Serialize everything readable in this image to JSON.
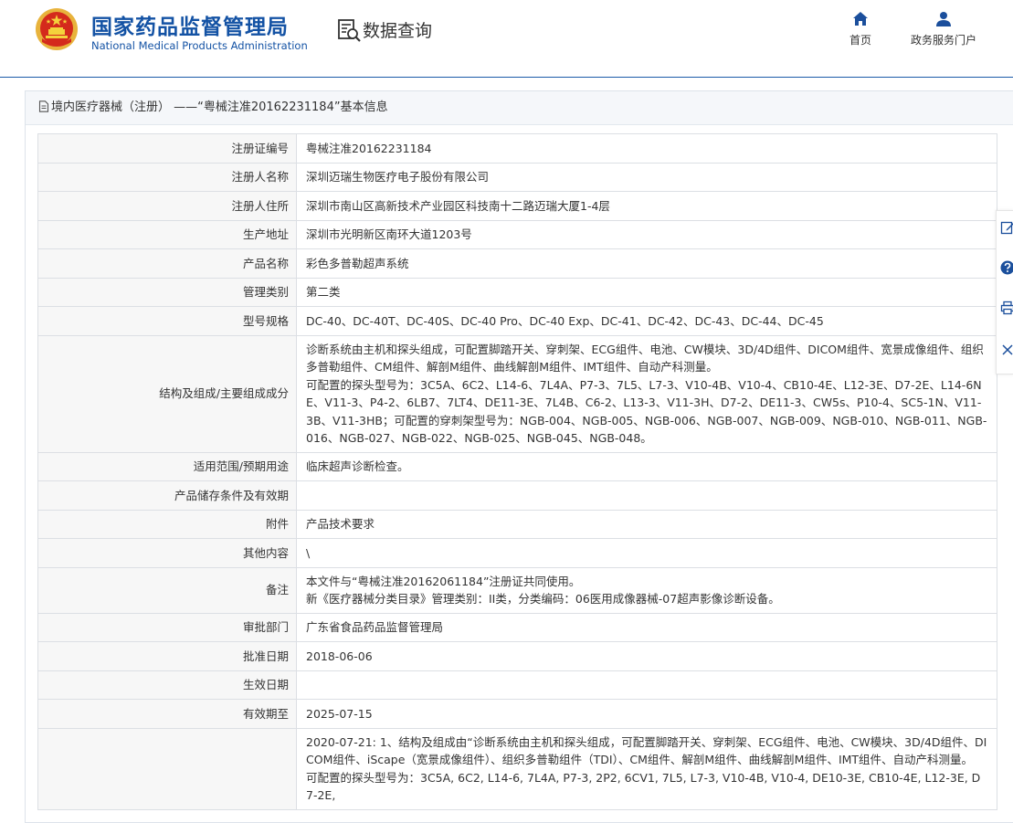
{
  "header": {
    "logo_cn": "国家药品监督管理局",
    "logo_en": "National Medical Products Administration",
    "section_title": "数据查询",
    "nav": [
      {
        "label": "首页",
        "icon": "home-icon"
      },
      {
        "label": "政务服务门户",
        "icon": "user-icon"
      }
    ],
    "brand_color": "#1352a4"
  },
  "panel": {
    "title": "境内医疗器械（注册） ——“粤械注准20162231184”基本信息"
  },
  "rows": [
    {
      "label": "注册证编号",
      "value": "粤械注准20162231184"
    },
    {
      "label": "注册人名称",
      "value": "深圳迈瑞生物医疗电子股份有限公司"
    },
    {
      "label": "注册人住所",
      "value": "深圳市南山区高新技术产业园区科技南十二路迈瑞大厦1-4层"
    },
    {
      "label": "生产地址",
      "value": "深圳市光明新区南环大道1203号"
    },
    {
      "label": "产品名称",
      "value": "彩色多普勒超声系统"
    },
    {
      "label": "管理类别",
      "value": "第二类"
    },
    {
      "label": "型号规格",
      "value": "DC-40、DC-40T、DC-40S、DC-40 Pro、DC-40 Exp、DC-41、DC-42、DC-43、DC-44、DC-45"
    },
    {
      "label": "结构及组成/主要组成成分",
      "lines": [
        "诊断系统由主机和探头组成，可配置脚踏开关、穿刺架、ECG组件、电池、CW模块、3D/4D组件、DICOM组件、宽景成像组件、组织多普勒组件、CM组件、解剖M组件、曲线解剖M组件、IMT组件、自动产科测量。",
        "可配置的探头型号为：3C5A、6C2、L14-6、7L4A、P7-3、7L5、L7-3、V10-4B、V10-4、CB10-4E、L12-3E、D7-2E、L14-6NE、V11-3、P4-2、6LB7、7LT4、DE11-3E、7L4B、C6-2、L13-3、V11-3H、D7-2、DE11-3、CW5s、P10-4、SC5-1N、V11-3B、V11-3HB；可配置的穿刺架型号为：NGB-004、NGB-005、NGB-006、NGB-007、NGB-009、NGB-010、NGB-011、NGB-016、NGB-027、NGB-022、NGB-025、NGB-045、NGB-048。"
      ]
    },
    {
      "label": "适用范围/预期用途",
      "value": "临床超声诊断检查。"
    },
    {
      "label": "产品储存条件及有效期",
      "value": ""
    },
    {
      "label": "附件",
      "value": "产品技术要求"
    },
    {
      "label": "其他内容",
      "value": "\\"
    },
    {
      "label": "备注",
      "lines": [
        "本文件与“粤械注准20162061184”注册证共同使用。",
        "新《医疗器械分类目录》管理类别：II类，分类编码：06医用成像器械-07超声影像诊断设备。"
      ]
    },
    {
      "label": "审批部门",
      "value": "广东省食品药品监督管理局"
    },
    {
      "label": "批准日期",
      "value": "2018-06-06"
    },
    {
      "label": "生效日期",
      "value": ""
    },
    {
      "label": "有效期至",
      "value": "2025-07-15"
    },
    {
      "label": "",
      "lines": [
        "2020-07-21: 1、结构及组成由“诊断系统由主机和探头组成，可配置脚踏开关、穿刺架、ECG组件、电池、CW模块、3D/4D组件、DICOM组件、iScape（宽景成像组件）、组织多普勒组件（TDI）、CM组件、解剖M组件、曲线解剖M组件、IMT组件、自动产科测量。",
        "可配置的探头型号为：3C5A, 6C2, L14-6, 7L4A, P7-3, 2P2, 6CV1, 7L5, L7-3, V10-4B, V10-4, DE10-3E, CB10-4E, L12-3E, D7-2E,"
      ]
    }
  ],
  "sidebar": {
    "icons": [
      "edit-icon",
      "help-icon",
      "print-icon",
      "close-icon"
    ]
  }
}
